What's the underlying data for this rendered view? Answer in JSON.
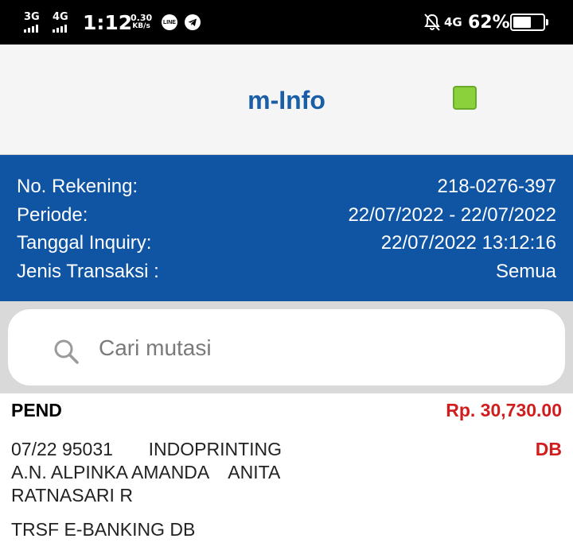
{
  "status_bar": {
    "network1": "3G",
    "network2": "4G",
    "time": "1:12",
    "speed_value": "0.30",
    "speed_unit": "KB/s",
    "line_icon_text": "LINE",
    "network3": "4G",
    "battery_percent": "62%",
    "battery_level": 0.62,
    "icons": [
      "line-app-icon",
      "telegram-icon",
      "notifications-off-icon",
      "battery-icon"
    ]
  },
  "header": {
    "title": "m-Info",
    "badge_color": "#8bd13b"
  },
  "account": {
    "rows": [
      {
        "label": "No. Rekening:",
        "value": "218-0276-397"
      },
      {
        "label": "Periode:",
        "value": "22/07/2022 - 22/07/2022"
      },
      {
        "label": "Tanggal Inquiry:",
        "value": "22/07/2022 13:12:16"
      },
      {
        "label": "Jenis Transaksi :",
        "value": "Semua"
      }
    ]
  },
  "search": {
    "placeholder": "Cari mutasi",
    "value": ""
  },
  "transaction": {
    "status": "PEND",
    "amount": "Rp. 30,730.00",
    "description": "07/22 95031       INDOPRINTING\nA.N. ALPINKA AMANDA    ANITA\nRATNASARI R",
    "type": "DB",
    "note": "TRSF E-BANKING DB",
    "accent_color": "#d01d1d"
  },
  "colors": {
    "primary": "#0f55a4",
    "title": "#1a5ea8"
  }
}
